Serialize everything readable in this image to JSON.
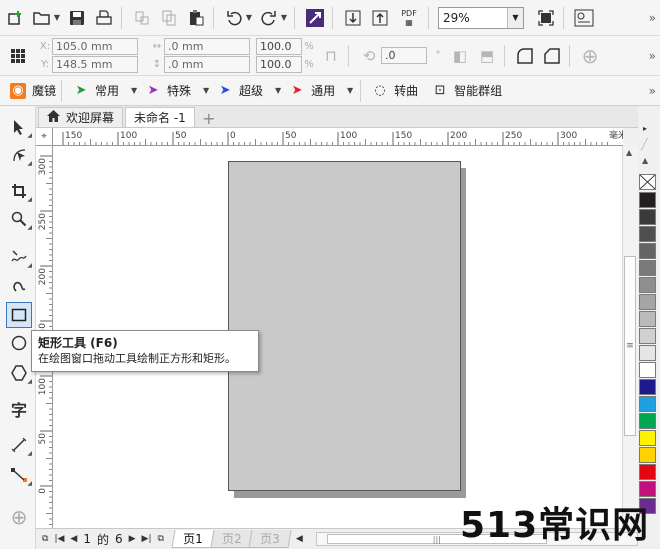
{
  "toolbar_standard": {
    "pdf_label": "PDF",
    "zoom_value": "29%"
  },
  "property_bar": {
    "x_label": "X:",
    "y_label": "Y:",
    "x_value": "105.0 mm",
    "y_value": "148.5 mm",
    "width_value": ".0 mm",
    "height_value": ".0 mm",
    "scale_w": "100.0",
    "scale_h": "100.0",
    "percent": "%",
    "rotation": ".0",
    "degree": "°"
  },
  "toolbar_effects": {
    "items": [
      "魔镜",
      "常用",
      "特殊",
      "超级",
      "通用",
      "转曲",
      "智能群组"
    ]
  },
  "tabs": {
    "welcome": "欢迎屏幕",
    "document": "未命名 -1"
  },
  "ruler": {
    "h_ticks": [
      "150",
      "100",
      "50",
      "0",
      "50",
      "100",
      "150",
      "200",
      "250",
      "300"
    ],
    "h_unit": "毫米",
    "v_ticks": [
      "300",
      "250",
      "200",
      "150",
      "100",
      "50",
      "0"
    ]
  },
  "tooltip": {
    "title": "矩形工具 (F6)",
    "description": "在绘图窗口拖动工具绘制正方形和矩形。"
  },
  "status": {
    "page_current": "1",
    "page_of": "的",
    "page_total": "6",
    "page_tabs": [
      "页1",
      "页2",
      "页3"
    ]
  },
  "palette": {
    "colors": [
      "#231f20",
      "#3a3a3a",
      "#4f4f4f",
      "#646464",
      "#7a7a7a",
      "#8f8f8f",
      "#a5a5a5",
      "#bababa",
      "#d0d0d0",
      "#e5e5e5",
      "#ffffff",
      "#1c1a8c",
      "#1ea0e0",
      "#00a650",
      "#fff200",
      "#ffd200",
      "#e30613",
      "#c0127a",
      "#6a2c8e"
    ]
  },
  "watermark": "513常识网"
}
